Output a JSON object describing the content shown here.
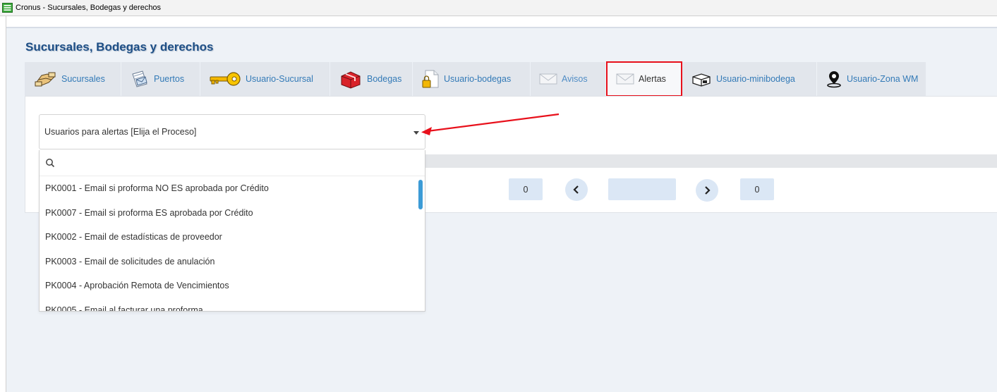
{
  "window": {
    "title": "Cronus - Sucursales, Bodegas y derechos"
  },
  "page": {
    "title": "Sucursales, Bodegas y derechos"
  },
  "tabs": [
    {
      "label": "Sucursales",
      "icon": "hands-icon",
      "active": false
    },
    {
      "label": "Puertos",
      "icon": "envelope-document-icon",
      "active": false
    },
    {
      "label": "Usuario-Sucursal",
      "icon": "key-icon",
      "active": false
    },
    {
      "label": "Bodegas",
      "icon": "gift-box-icon",
      "active": false
    },
    {
      "label": "Usuario-bodegas",
      "icon": "lock-document-icon",
      "active": false
    },
    {
      "label": "Avisos",
      "icon": "mail-icon",
      "active": false
    },
    {
      "label": "Alertas",
      "icon": "mail-icon",
      "active": true
    },
    {
      "label": "Usuario-minibodega",
      "icon": "open-box-icon",
      "active": false
    },
    {
      "label": "Usuario-Zona WM",
      "icon": "location-pin-icon",
      "active": false
    }
  ],
  "select": {
    "value": "Usuarios para alertas [Elija el Proceso]"
  },
  "dropdown": {
    "search_placeholder": "",
    "options": [
      "PK0001 - Email si proforma NO ES aprobada por Crédito",
      "PK0007 - Email si proforma ES aprobada por Crédito",
      "PK0002 - Email de estadísticas de proveedor",
      "PK0003 - Email de solicitudes de anulación",
      "PK0004 - Aprobación Remota de Vencimientos",
      "PK0005 - Email al facturar una proforma"
    ]
  },
  "pager": {
    "first_value": "0",
    "last_value": "0"
  },
  "colors": {
    "accent": "#337ab7",
    "title": "#1e4f86",
    "highlight": "#e8101b",
    "scrollbar": "#3c9bd6"
  }
}
